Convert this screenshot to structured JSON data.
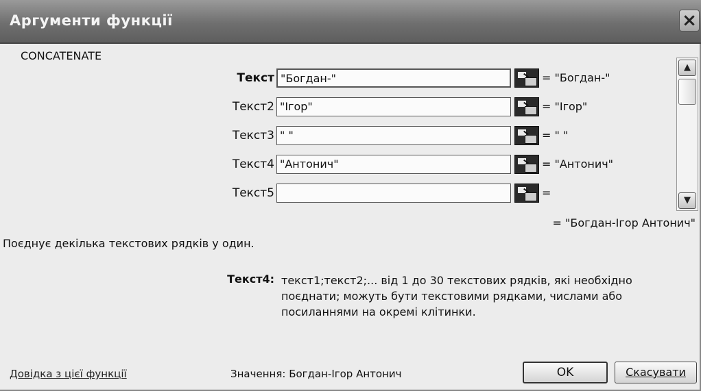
{
  "window": {
    "title": "Аргументи функції",
    "close_label": "×"
  },
  "function_name": "CONCATENATE",
  "arguments": [
    {
      "label": "Текст",
      "value": "\"Богдан-\"",
      "result": "= \"Богдан-\""
    },
    {
      "label": "Текст2",
      "value": "\"Ігор\"",
      "result": "= \"Ігор\""
    },
    {
      "label": "Текст3",
      "value": "\" \"",
      "result": "= \" \""
    },
    {
      "label": "Текст4",
      "value": "\"Антонич\"",
      "result": "= \"Антонич\""
    },
    {
      "label": "Текст5",
      "value": "",
      "result": "="
    }
  ],
  "total_result": "= \"Богдан-Ігор Антонич\"",
  "description": "Поєднує декілька текстових рядків у один.",
  "help": {
    "arg_name": "Текст4:",
    "arg_text": "текст1;текст2;... від 1 до 30 текстових рядків, які необхідно поєднати; можуть бути текстовими рядками, числами або посиланнями на окремі клітинки."
  },
  "footer": {
    "help_link": "Довідка з цієї функції",
    "value_label": "Значення:",
    "value": "Богдан-Ігор Антонич",
    "ok_label": "OK",
    "cancel_label": "Скасувати"
  },
  "scrollbar": {
    "up_icon": "▲",
    "down_icon": "▼"
  }
}
